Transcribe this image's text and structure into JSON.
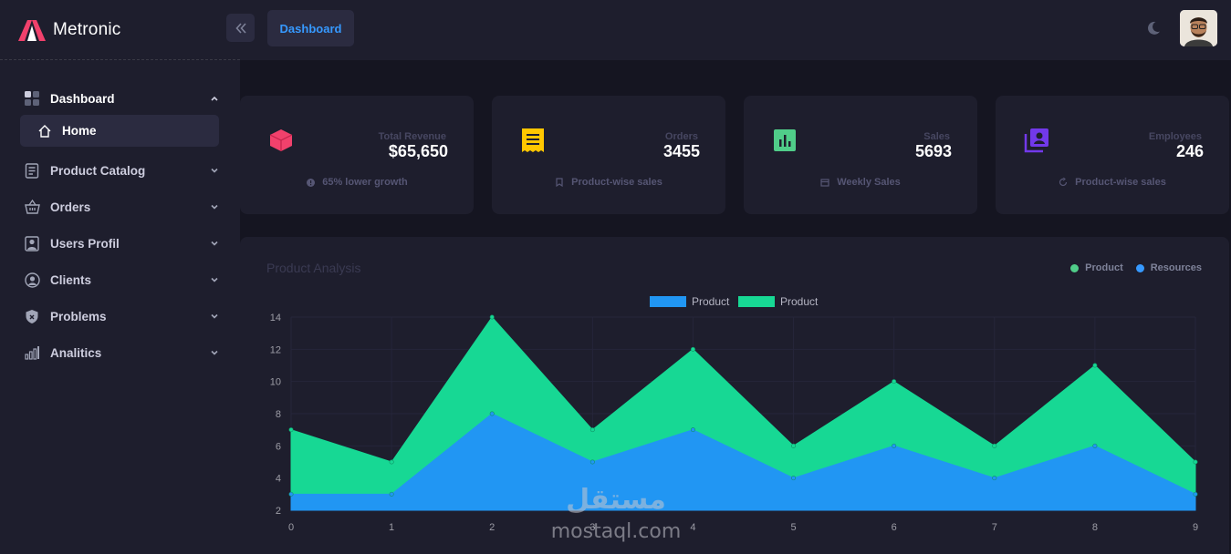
{
  "brand": {
    "name": "Metronic"
  },
  "header": {
    "active_tab": "Dashboard"
  },
  "sidebar": {
    "items": [
      {
        "label": "Dashboard",
        "icon": "dashboard-grid-icon",
        "expanded": true
      },
      {
        "label": "Home",
        "icon": "home-icon",
        "sub": true
      },
      {
        "label": "Product Catalog",
        "icon": "catalog-icon"
      },
      {
        "label": "Orders",
        "icon": "basket-icon"
      },
      {
        "label": "Users Profil",
        "icon": "user-card-icon"
      },
      {
        "label": "Clients",
        "icon": "user-circle-icon"
      },
      {
        "label": "Problems",
        "icon": "shield-icon"
      },
      {
        "label": "Analitics",
        "icon": "bar-chart-icon"
      }
    ]
  },
  "cards": [
    {
      "label": "Total Revenue",
      "value": "$65,650",
      "footer": "65% lower growth",
      "icon": "cube-icon",
      "color": "#f1416c"
    },
    {
      "label": "Orders",
      "value": "3455",
      "footer": "Product-wise sales",
      "icon": "receipt-icon",
      "color": "#ffc700"
    },
    {
      "label": "Sales",
      "value": "5693",
      "footer": "Weekly Sales",
      "icon": "chart-icon",
      "color": "#50cd89"
    },
    {
      "label": "Employees",
      "value": "246",
      "footer": "Product-wise sales",
      "icon": "contacts-icon",
      "color": "#7239ea"
    }
  ],
  "panel": {
    "title": "Product Analysis",
    "legend": [
      {
        "label": "Product",
        "color": "#50cd89"
      },
      {
        "label": "Resources",
        "color": "#3699ff"
      }
    ]
  },
  "chart_data": {
    "type": "area",
    "x": [
      0,
      1,
      2,
      3,
      4,
      5,
      6,
      7,
      8,
      9
    ],
    "ylim": [
      2,
      14
    ],
    "yticks": [
      2,
      4,
      6,
      8,
      10,
      12,
      14
    ],
    "stacked": true,
    "series": [
      {
        "name": "Product",
        "color": "#2196f3",
        "values": [
          3,
          3,
          8,
          5,
          7,
          4,
          6,
          4,
          6,
          3
        ]
      },
      {
        "name": "Product",
        "color": "#17d894",
        "values": [
          7,
          5,
          14,
          7,
          12,
          6,
          10,
          6,
          11,
          5
        ]
      }
    ],
    "grid": true,
    "legend_position": "top"
  },
  "watermark": {
    "arabic": "مستقل",
    "latin": "mostaql.com"
  }
}
